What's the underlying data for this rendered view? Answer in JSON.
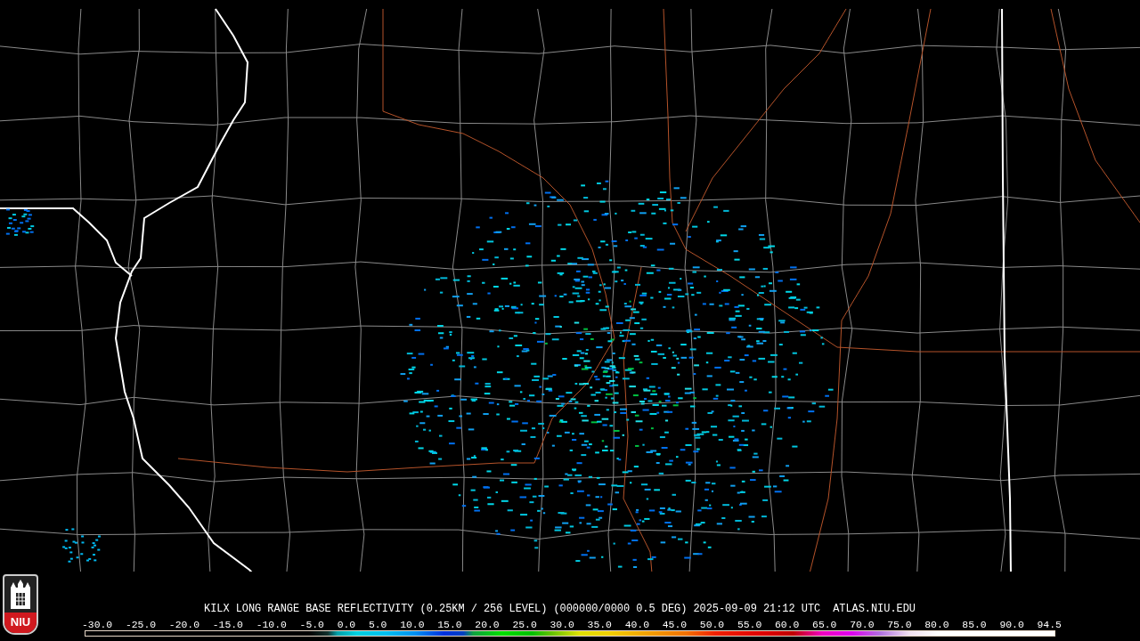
{
  "caption": {
    "title": "KILX LONG RANGE BASE REFLECTIVITY (0.25KM / 256 LEVEL) (000000/0000 0.5 DEG) 2025-09-09 21:12 UTC",
    "source": "ATLAS.NIU.EDU"
  },
  "logo": {
    "text": "NIU"
  },
  "legend": {
    "labels": [
      "-30.0",
      "-25.0",
      "-20.0",
      "-15.0",
      "-10.0",
      "-5.0",
      "0.0",
      "5.0",
      "10.0",
      "15.0",
      "20.0",
      "25.0",
      "30.0",
      "35.0",
      "40.0",
      "45.0",
      "50.0",
      "55.0",
      "60.0",
      "65.0",
      "70.0",
      "75.0",
      "80.0",
      "85.0",
      "90.0",
      "94.5"
    ]
  }
}
